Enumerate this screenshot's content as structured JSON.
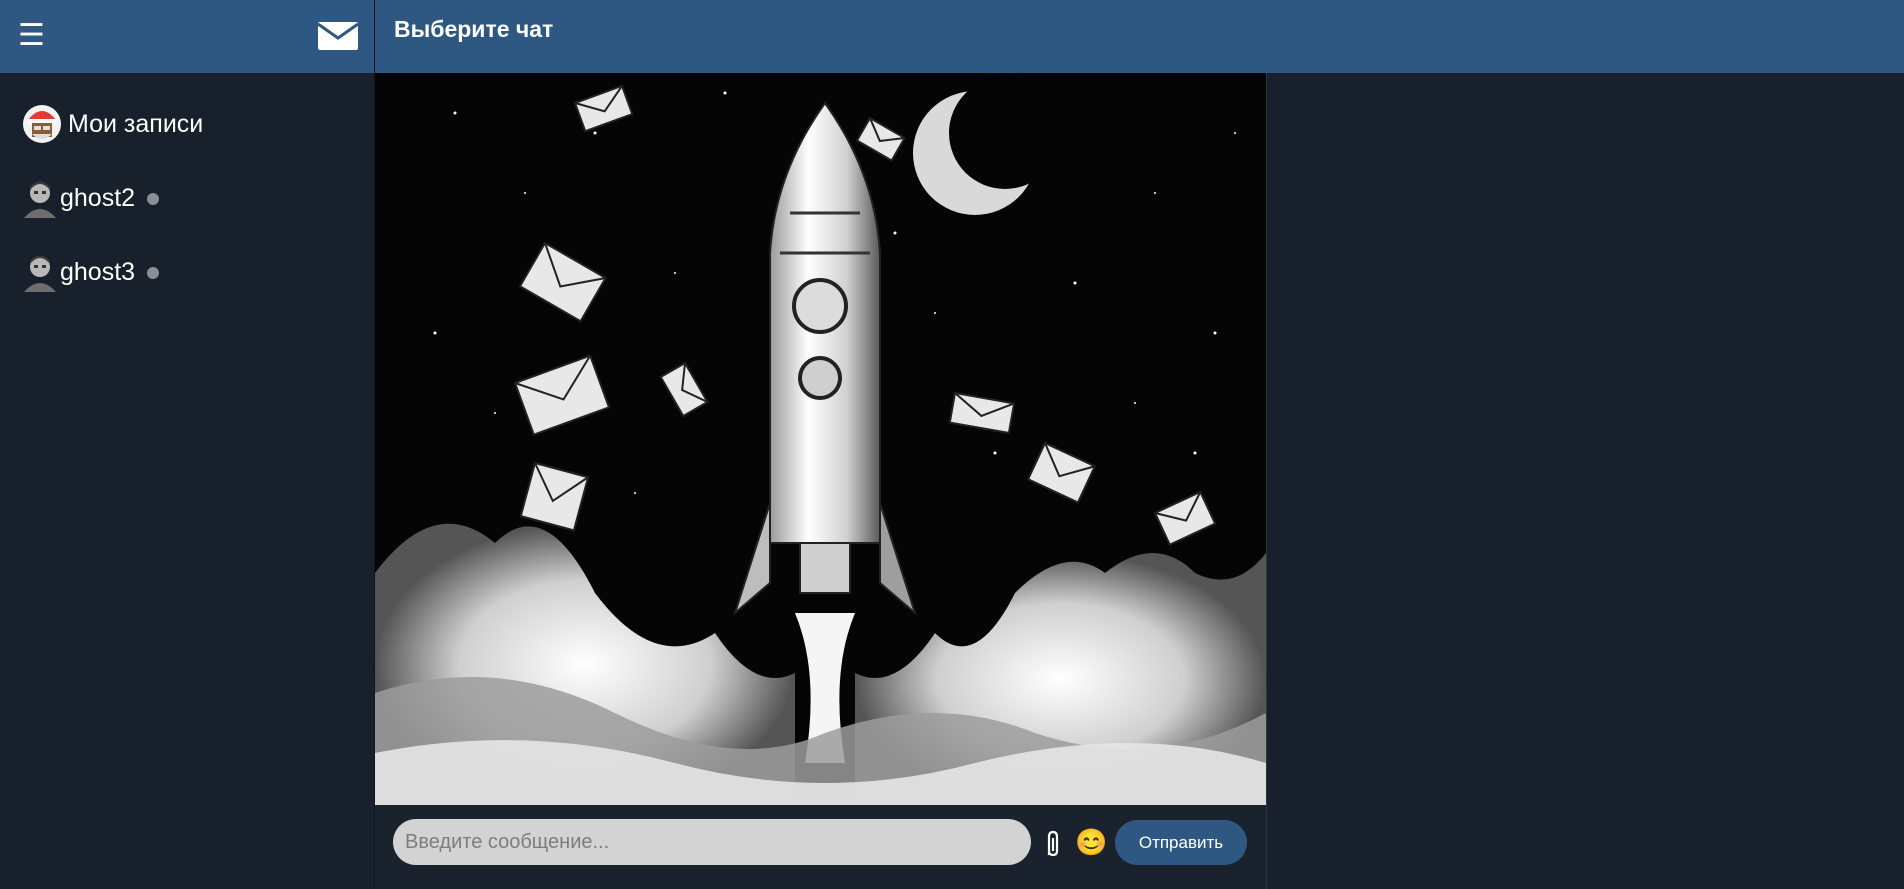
{
  "sidebar": {
    "menu_icon": "hamburger-icon",
    "mail_icon": "envelope-icon",
    "chats": [
      {
        "name": "Мои записи",
        "avatar": "santa-avatar",
        "status": null
      },
      {
        "name": "ghost2",
        "avatar": "user-avatar",
        "status": "offline"
      },
      {
        "name": "ghost3",
        "avatar": "user-avatar",
        "status": "offline"
      }
    ]
  },
  "main": {
    "title": "Выберите чат"
  },
  "composer": {
    "placeholder": "Введите сообщение...",
    "attach_icon": "paperclip-icon",
    "emoji": "😊",
    "send_label": "Отправить"
  },
  "colors": {
    "header": "#2e5882",
    "background": "#17202b",
    "send_button": "#2e5882",
    "input_bg": "#d3d3d3",
    "status_offline": "#8a8f96"
  }
}
